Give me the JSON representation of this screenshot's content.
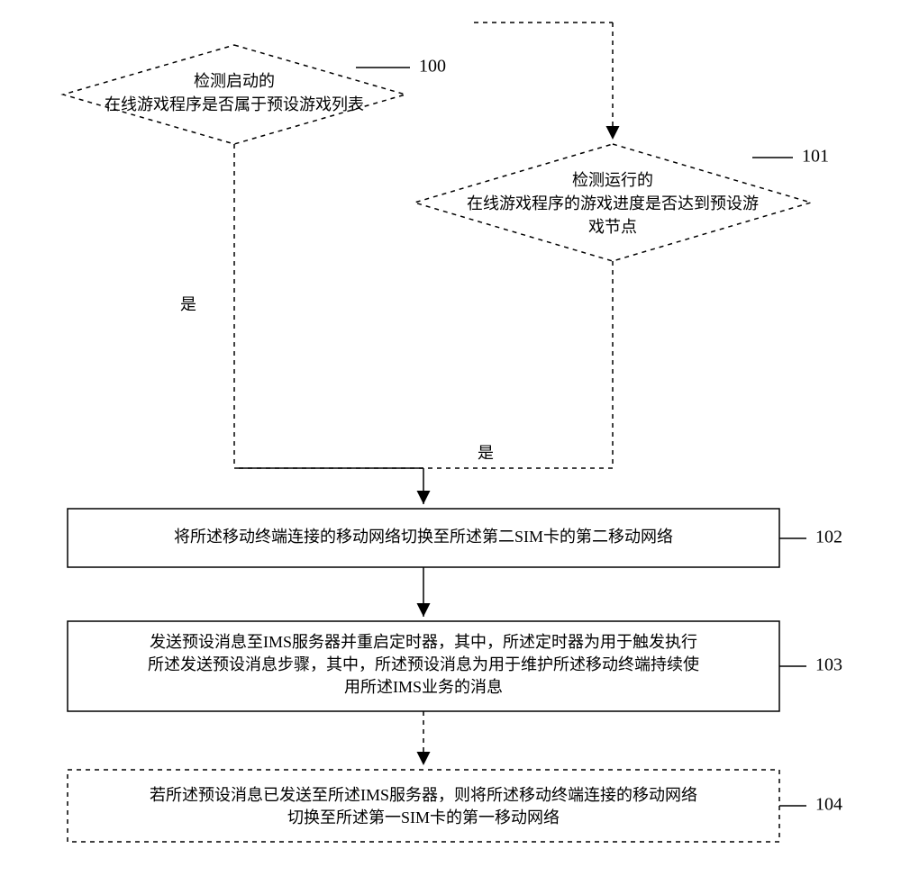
{
  "chart_data": {
    "type": "flowchart",
    "nodes": [
      {
        "id": 100,
        "type": "decision",
        "dashed": true,
        "text": [
          "检测启动的",
          "在线游戏程序是否属于预设游戏列表"
        ]
      },
      {
        "id": 101,
        "type": "decision",
        "dashed": true,
        "text": [
          "检测运行的",
          "在线游戏程序的游戏进度是否达到预设游",
          "戏节点"
        ]
      },
      {
        "id": 102,
        "type": "process",
        "dashed": false,
        "text": [
          "将所述移动终端连接的移动网络切换至所述第二SIM卡的第二移动网络"
        ]
      },
      {
        "id": 103,
        "type": "process",
        "dashed": false,
        "text": [
          "发送预设消息至IMS服务器并重启定时器，其中，所述定时器为用于触发执行",
          "所述发送预设消息步骤，其中，所述预设消息为用于维护所述移动终端持续使",
          "用所述IMS业务的消息"
        ]
      },
      {
        "id": 104,
        "type": "process",
        "dashed": true,
        "text": [
          "若所述预设消息已发送至所述IMS服务器，则将所述移动终端连接的移动网络",
          "切换至所述第一SIM卡的第一移动网络"
        ]
      }
    ],
    "edges": [
      {
        "from": 100,
        "to": 102,
        "label": "是",
        "dashed": true
      },
      {
        "from": 100,
        "to": 101,
        "dashed": true,
        "note": "top-right entry"
      },
      {
        "from": 101,
        "to": 102,
        "label": "是",
        "dashed": true
      },
      {
        "from": 102,
        "to": 103,
        "dashed": false
      },
      {
        "from": 103,
        "to": 104,
        "dashed": true
      }
    ]
  },
  "nodes": {
    "n100": {
      "num": "100",
      "l1": "检测启动的",
      "l2": "在线游戏程序是否属于预设游戏列表"
    },
    "n101": {
      "num": "101",
      "l1": "检测运行的",
      "l2": "在线游戏程序的游戏进度是否达到预设游",
      "l3": "戏节点"
    },
    "n102": {
      "num": "102",
      "l1": "将所述移动终端连接的移动网络切换至所述第二SIM卡的第二移动网络"
    },
    "n103": {
      "num": "103",
      "l1": "发送预设消息至IMS服务器并重启定时器，其中，所述定时器为用于触发执行",
      "l2": "所述发送预设消息步骤，其中，所述预设消息为用于维护所述移动终端持续使",
      "l3": "用所述IMS业务的消息"
    },
    "n104": {
      "num": "104",
      "l1": "若所述预设消息已发送至所述IMS服务器，则将所述移动终端连接的移动网络",
      "l2": "切换至所述第一SIM卡的第一移动网络"
    }
  },
  "labels": {
    "yes100": "是",
    "yes101": "是"
  }
}
